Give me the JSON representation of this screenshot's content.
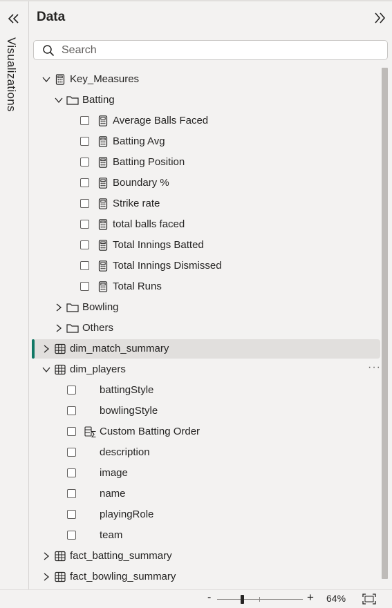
{
  "visualizations_label": "Visualizations",
  "pane": {
    "title": "Data",
    "search_placeholder": "Search"
  },
  "tree": {
    "key_measures": {
      "label": "Key_Measures",
      "batting": {
        "label": "Batting",
        "items": [
          "Average Balls Faced",
          "Batting Avg",
          "Batting Position",
          "Boundary %",
          "Strike rate",
          "total balls faced",
          "Total Innings Batted",
          "Total Innings Dismissed",
          "Total Runs"
        ]
      },
      "bowling": {
        "label": "Bowling"
      },
      "others": {
        "label": "Others"
      }
    },
    "dim_match_summary": {
      "label": "dim_match_summary"
    },
    "dim_players": {
      "label": "dim_players",
      "more": "···",
      "fields": [
        "battingStyle",
        "bowlingStyle",
        "Custom Batting Order",
        "description",
        "image",
        "name",
        "playingRole",
        "team"
      ]
    },
    "fact_batting_summary": {
      "label": "fact_batting_summary"
    },
    "fact_bowling_summary": {
      "label": "fact_bowling_summary"
    }
  },
  "footer": {
    "zoom_minus": "-",
    "zoom_plus": "+",
    "zoom_level": "64%"
  },
  "colors": {
    "selection_accent": "#117865",
    "pane_background": "#f3f2f1"
  }
}
